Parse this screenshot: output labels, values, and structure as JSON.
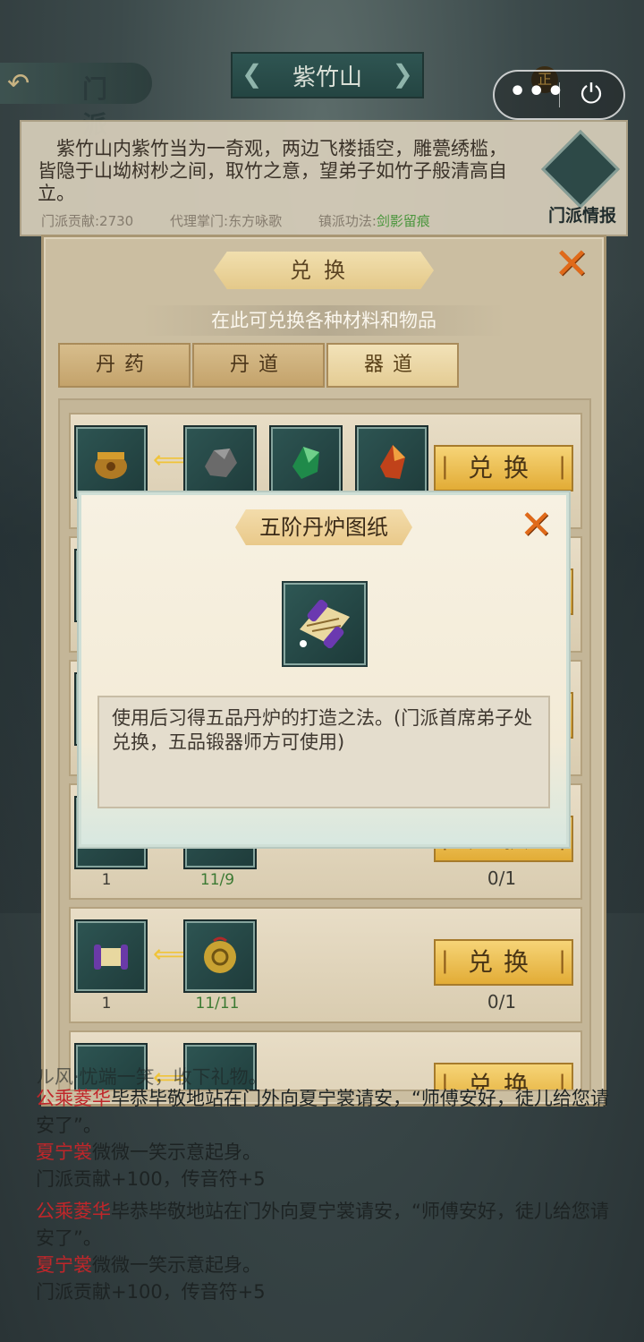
{
  "topbar": {
    "back_icon": "back-arrow-icon",
    "section_title": "门派",
    "mountain_name": "紫竹山",
    "badge": "正",
    "capsule_more": "•••",
    "capsule_power": "⏻"
  },
  "description": {
    "text": "紫竹山内紫竹当为一奇观，两边飞楼插空，雕甍绣槛，皆隐于山坳树杪之间，取竹之意，望弟子如竹子般清高自立。",
    "stats": {
      "contribution": "门派贡献:2730",
      "acting_leader": "代理掌门:东方咏歌",
      "technique_label": "镇派功法:",
      "technique_value": "剑影留痕"
    },
    "intel_label": "门派情报"
  },
  "exchange": {
    "title": "兑换",
    "subtitle": "在此可兑换各种材料和物品",
    "tabs": [
      "丹药",
      "丹道",
      "器道"
    ],
    "active_tab": "器道",
    "button_label": "兑换",
    "rows": [
      {
        "target_icon": "bronze-cauldron-icon",
        "inputs": [
          "gray-ore-icon",
          "green-crystal-icon",
          "red-crystal-icon"
        ],
        "target_count": "",
        "input_counts": [],
        "limit": ""
      },
      {
        "target_icon": "cauldron-icon",
        "inputs": [
          "jade-disc-icon"
        ],
        "target_count": "1",
        "input_counts": [
          "11/9"
        ],
        "limit": "0/1"
      },
      {
        "target_icon": "scroll-icon",
        "inputs": [
          "gold-disc-icon"
        ],
        "target_count": "1",
        "input_counts": [
          "11/11"
        ],
        "limit": "0/1"
      },
      {
        "target_icon": "scroll-icon",
        "inputs": [
          "gold-disc-icon"
        ],
        "target_count": "",
        "input_counts": [],
        "limit": ""
      }
    ]
  },
  "popup": {
    "title": "五阶丹炉图纸",
    "item_icon": "purple-scroll-icon",
    "description": "使用后习得五品丹炉的打造之法。(门派首席弟子处兑换，五品锻器师方可使用)"
  },
  "log": {
    "cut_line": "ル风·忧端一笑，收下礼物。",
    "entries": [
      {
        "name": "公乘菱华",
        "text": "毕恭毕敬地站在门外向夏宁裳请安，“师傅安好，徒儿给您请安了”。"
      },
      {
        "name": "夏宁裳",
        "text": "微微一笑示意起身。"
      },
      {
        "name": "",
        "text": "门派贡献+100，传音符+5"
      },
      {
        "name": "公乘菱华",
        "text": "毕恭毕敬地站在门外向夏宁裳请安，“师傅安好，徒儿给您请安了”。"
      },
      {
        "name": "夏宁裳",
        "text": "微微一笑示意起身。"
      },
      {
        "name": "",
        "text": "门派贡献+100，传音符+5"
      }
    ]
  },
  "colors": {
    "name_red": "#c0262a",
    "button_gold": "#e2ac36",
    "close_orange": "#e06a1a"
  }
}
